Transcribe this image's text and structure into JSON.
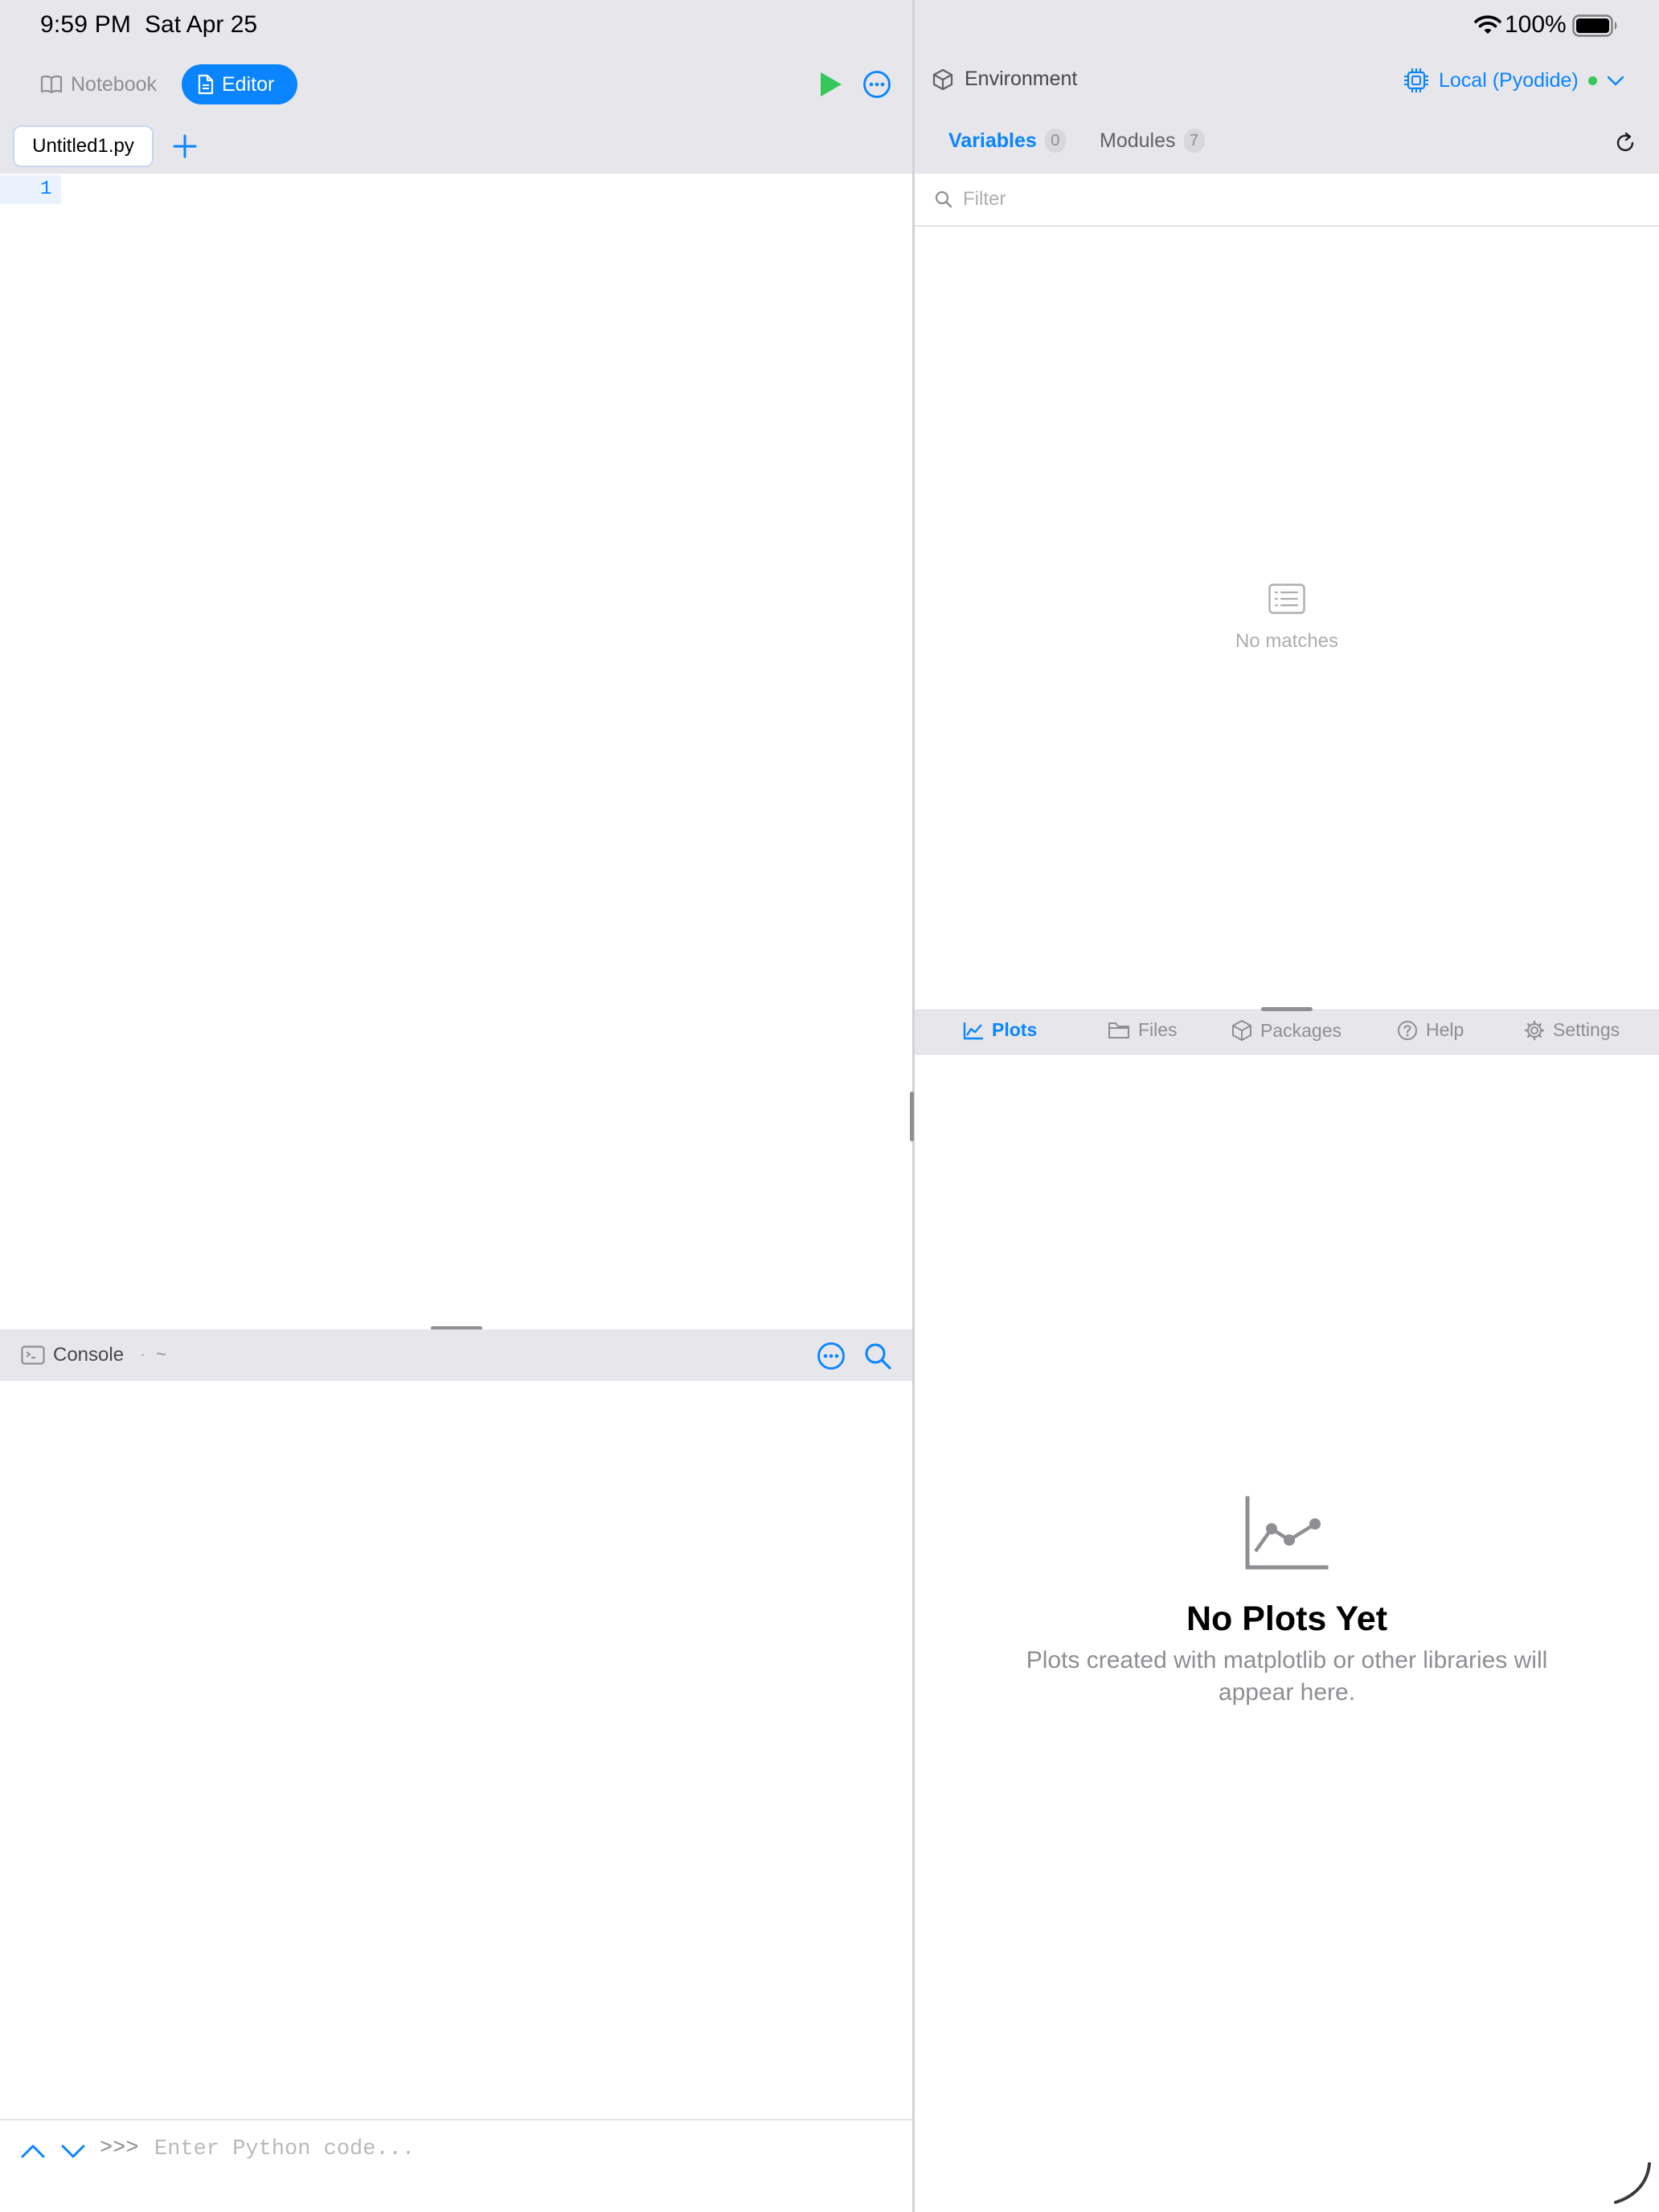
{
  "status_bar": {
    "time": "9:59 PM",
    "date": "Sat Apr 25",
    "battery": "100%",
    "icons": [
      "wifi-icon",
      "battery-icon"
    ]
  },
  "editor_pane": {
    "mode_tabs": [
      {
        "label": "Notebook",
        "icon": "book-icon",
        "selected": false
      },
      {
        "label": "Editor",
        "icon": "document-icon",
        "selected": true
      }
    ],
    "toolbar_icons": [
      "play-icon",
      "more-icon"
    ],
    "file_tabs": [
      {
        "label": "Untitled1.py",
        "selected": true
      }
    ],
    "line_numbers": [
      "1"
    ]
  },
  "console": {
    "title": "Console",
    "separator": "·",
    "path": "~",
    "prompt": ">>>",
    "input_placeholder": "Enter Python code...",
    "icons": [
      "terminal-icon",
      "more-icon",
      "search-icon",
      "chevron-up-icon",
      "chevron-down-icon"
    ]
  },
  "environment": {
    "title": "Environment",
    "runtime_label": "Local (Pyodide)",
    "runtime_status_color": "#34c759",
    "tabs": [
      {
        "label": "Variables",
        "count": "0",
        "selected": true
      },
      {
        "label": "Modules",
        "count": "7",
        "selected": false
      }
    ],
    "filter_placeholder": "Filter",
    "empty_text": "No matches"
  },
  "bottom_panel": {
    "tabs": [
      {
        "label": "Plots",
        "icon": "chart-icon",
        "selected": true
      },
      {
        "label": "Files",
        "icon": "folder-icon",
        "selected": false
      },
      {
        "label": "Packages",
        "icon": "package-icon",
        "selected": false
      },
      {
        "label": "Help",
        "icon": "help-icon",
        "selected": false
      },
      {
        "label": "Settings",
        "icon": "gear-icon",
        "selected": false
      }
    ],
    "empty_title": "No Plots Yet",
    "empty_subtitle_line1": "Plots created with matplotlib or other libraries will",
    "empty_subtitle_line2": "appear here."
  },
  "colors": {
    "accent": "#0a84ff",
    "run_green": "#34c759",
    "header_bg": "#e6e6eb"
  }
}
